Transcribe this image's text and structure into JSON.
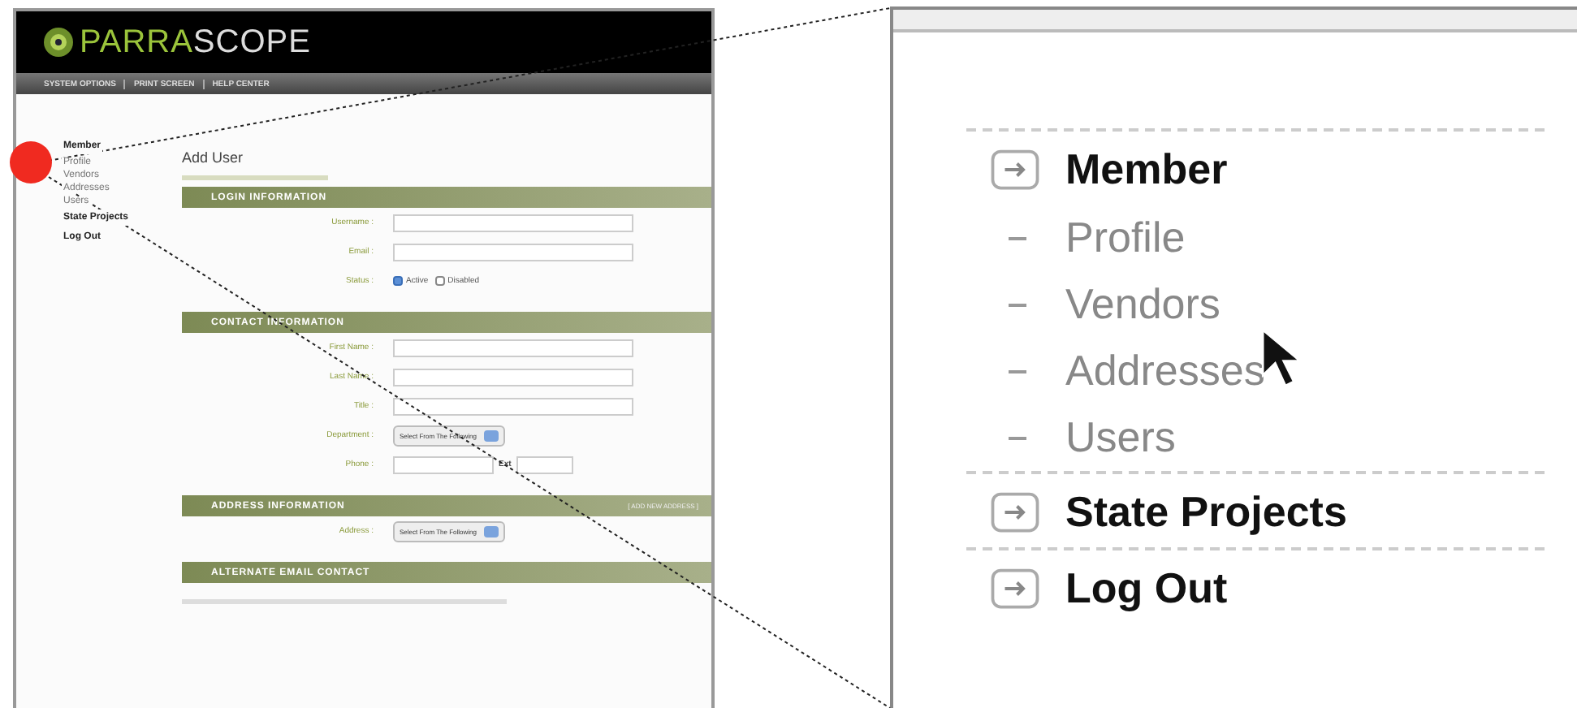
{
  "mockup": {
    "logo": {
      "first": "PARRA",
      "second": "SCOPE"
    },
    "toolbar": [
      "SYSTEM OPTIONS",
      "PRINT SCREEN",
      "HELP CENTER"
    ],
    "sidebar": [
      {
        "label": "Member",
        "children": [
          {
            "label": "Profile"
          },
          {
            "label": "Vendors"
          },
          {
            "label": "Addresses"
          },
          {
            "label": "Users"
          }
        ]
      },
      {
        "label": "State Projects"
      },
      {
        "label": "Log Out"
      }
    ],
    "page_title": "Add User",
    "sections": [
      {
        "title": "LOGIN INFORMATION",
        "fields": [
          {
            "kind": "text",
            "label": "Username :"
          },
          {
            "kind": "text",
            "label": "Email :"
          },
          {
            "kind": "radio",
            "label": "Status :",
            "options": [
              {
                "label": "Active",
                "selected": true
              },
              {
                "label": "Disabled",
                "selected": false
              }
            ]
          }
        ]
      },
      {
        "title": "CONTACT INFORMATION",
        "fields": [
          {
            "kind": "text",
            "label": "First Name :"
          },
          {
            "kind": "text",
            "label": "Last Name :"
          },
          {
            "kind": "text",
            "label": "Title :"
          },
          {
            "kind": "select",
            "label": "Department :",
            "value": "Select From The Following"
          },
          {
            "kind": "phone",
            "label": "Phone :",
            "ext": "Ext"
          }
        ]
      },
      {
        "title": "ADDRESS INFORMATION",
        "action": "[ ADD NEW ADDRESS ]",
        "fields": [
          {
            "kind": "select",
            "label": "Address :",
            "value": "Select From The Following"
          }
        ]
      },
      {
        "title": "ALTERNATE EMAIL CONTACT"
      }
    ]
  },
  "zoom_inset": {
    "items": [
      {
        "label": "Member",
        "children": [
          {
            "label": "Profile"
          },
          {
            "label": "Vendors"
          },
          {
            "label": "Addresses"
          },
          {
            "label": "Users"
          }
        ]
      },
      {
        "label": "State Projects"
      },
      {
        "label": "Log Out"
      }
    ]
  }
}
